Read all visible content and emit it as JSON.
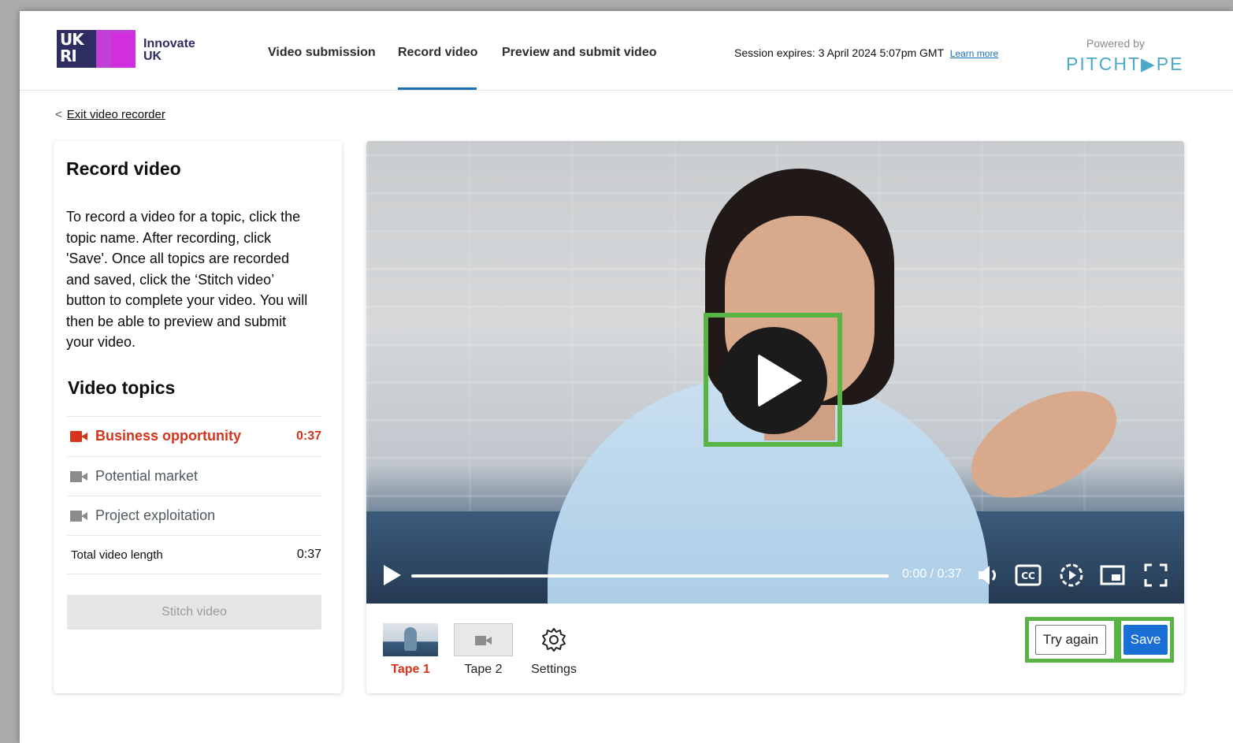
{
  "header": {
    "logo_ukri": "UK\nRI",
    "logo_brand_line1": "Innovate",
    "logo_brand_line2": "UK",
    "nav": [
      {
        "label": "Video submission",
        "active": false
      },
      {
        "label": "Record video",
        "active": true
      },
      {
        "label": "Preview and submit video",
        "active": false
      }
    ],
    "session_text": "Session expires: 3 April 2024 5:07pm GMT",
    "learn_more": "Learn more",
    "powered_by": "Powered by",
    "provider": "PITCHT▶PE"
  },
  "back_link": {
    "chevron": "<",
    "label": "Exit video recorder"
  },
  "sidebar": {
    "title": "Record video",
    "intro": "To record a video for a topic, click the topic name. After recording, click 'Save'. Once all topics are recorded and saved, click the ‘Stitch video’ button to complete your video. You will then be able to preview and submit your video.",
    "topics_title": "Video topics",
    "topics": [
      {
        "label": "Business opportunity",
        "duration": "0:37",
        "active": true,
        "icon": "video-camera-icon"
      },
      {
        "label": "Potential market",
        "duration": "",
        "active": false,
        "icon": "video-camera-icon"
      },
      {
        "label": "Project exploitation",
        "duration": "",
        "active": false,
        "icon": "video-camera-icon"
      }
    ],
    "total_label": "Total video length",
    "total_value": "0:37",
    "stitch_button": "Stitch video"
  },
  "player": {
    "time": "0:00 / 0:37",
    "progress": 0,
    "icons": [
      "play-icon",
      "volume-icon",
      "captions-icon",
      "playback-speed-icon",
      "picture-in-picture-icon",
      "fullscreen-icon"
    ]
  },
  "toolbar": {
    "tapes": [
      {
        "label": "Tape 1",
        "active": true
      },
      {
        "label": "Tape 2",
        "active": false
      }
    ],
    "settings_label": "Settings",
    "try_again": "Try again",
    "save": "Save"
  },
  "colors": {
    "accent_blue": "#1d70b8",
    "save_blue": "#1a6fd6",
    "active_red": "#d4351c",
    "highlight_green": "#59b446",
    "ukri_navy": "#2e2d62",
    "ukri_purple": "#c13fd6"
  }
}
